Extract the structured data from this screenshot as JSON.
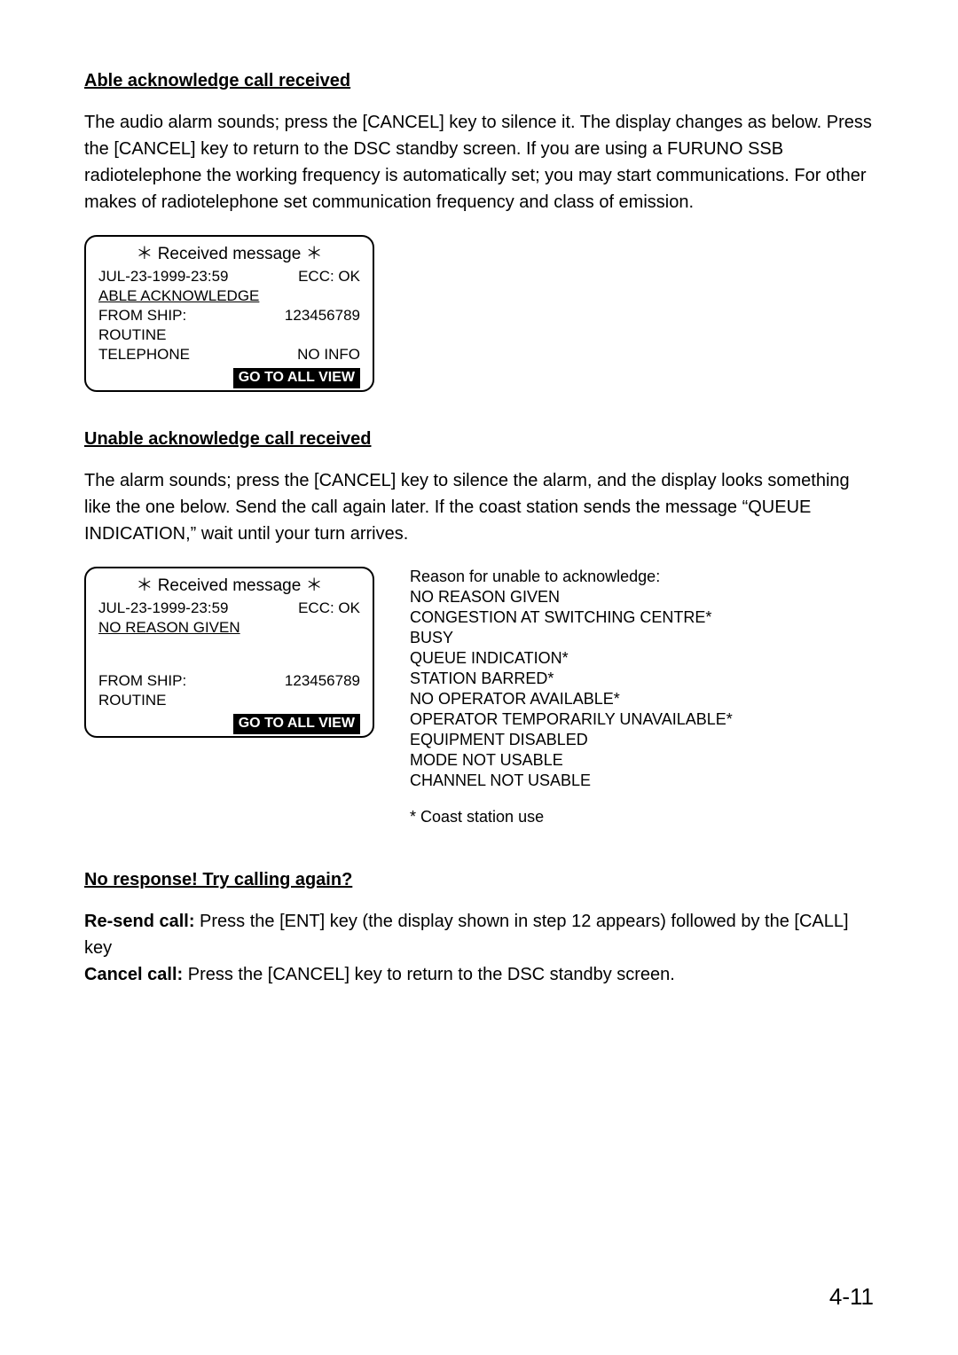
{
  "section1": {
    "heading": "Able acknowledge call received",
    "paragraph": "The audio alarm sounds; press the [CANCEL] key to silence it. The display changes as below. Press the [CANCEL] key to return to the DSC standby screen. If you are using a FURUNO SSB radiotelephone the working frequency is automatically set; you may start communications. For other makes of radiotelephone set communication frequency and class of emission."
  },
  "screen1": {
    "title": "＊ Received message ＊",
    "timestamp": "JUL-23-1999-23:59",
    "ecc": "ECC: OK",
    "ack_line": "ABLE ACKNOWLEDGE",
    "from_label": "FROM SHIP:",
    "from_id": "123456789",
    "category": "ROUTINE",
    "telecom": "TELEPHONE",
    "telecom_info": "NO INFO",
    "button": "GO TO ALL VIEW"
  },
  "section2": {
    "heading": "Unable acknowledge call received",
    "paragraph": "The alarm sounds; press the [CANCEL] key to silence the alarm, and the display looks something like the one below. Send the call again later. If the coast station sends the message “QUEUE INDICATION,” wait until your turn arrives."
  },
  "screen2": {
    "title": "＊ Received message ＊",
    "timestamp": "JUL-23-1999-23:59",
    "ecc": "ECC: OK",
    "reason_line": "NO REASON GIVEN",
    "from_label": "FROM SHIP:",
    "from_id": "123456789",
    "category": "ROUTINE",
    "button": "GO TO ALL VIEW"
  },
  "reasons": {
    "intro": "Reason for unable to acknowledge:",
    "list": [
      "NO REASON GIVEN",
      "CONGESTION AT SWITCHING CENTRE*",
      "BUSY",
      "QUEUE INDICATION*",
      "STATION BARRED*",
      "NO OPERATOR AVAILABLE*",
      "OPERATOR TEMPORARILY UNAVAILABLE*",
      "EQUIPMENT DISABLED",
      "MODE NOT USABLE",
      "CHANNEL NOT USABLE"
    ],
    "footnote": "* Coast station use"
  },
  "section3": {
    "heading": "No response! Try calling again?",
    "resend_label": "Re-send call:",
    "resend_text": " Press the [ENT] key (the display shown in step 12 appears) followed by the [CALL] key",
    "cancel_label": "Cancel call:",
    "cancel_text": " Press the [CANCEL] key to return to the DSC standby screen."
  },
  "page_number": "4-11"
}
